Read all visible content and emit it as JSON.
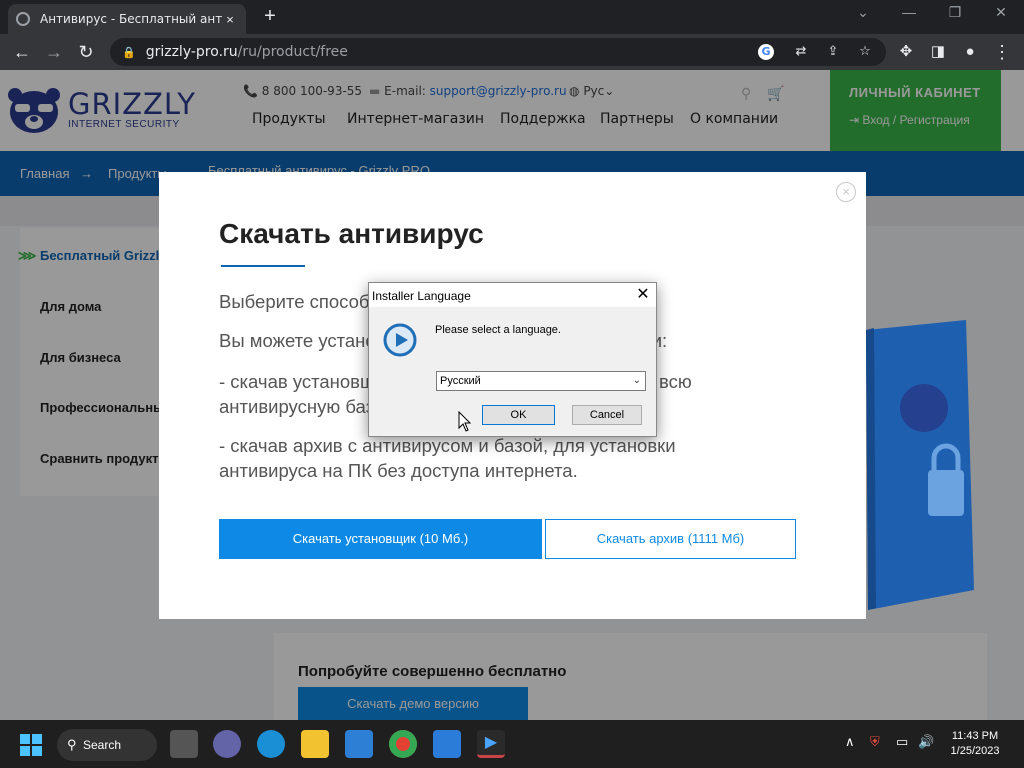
{
  "browser": {
    "tab_title": "Антивирус - Бесплатный антиви",
    "tab_close": "×",
    "new_tab": "+",
    "url_host": "grizzly-pro.ru",
    "url_path": "/ru/product/free"
  },
  "site": {
    "logo_text": "GRIZZLY",
    "logo_sub": "INTERNET SECURITY",
    "phone": "8 800 100-93-55",
    "email_label": "E-mail:",
    "email": "support@grizzly-pro.ru",
    "language": "Рус",
    "nav": [
      "Продукты",
      "Интернет-магазин",
      "Поддержка",
      "Партнеры",
      "О компании"
    ],
    "cabinet_title": "ЛИЧНЫЙ КАБИНЕТ",
    "cabinet_login": "Вход / Регистрация",
    "breadcrumbs": [
      "Главная",
      "→",
      "Продукты",
      "Бесплатный антивирус - Grizzly PRO"
    ],
    "sidebar": [
      "Бесплатный Grizzly PRO",
      "Для дома",
      "Для бизнеса",
      "Профессиональный",
      "Сравнить продукты"
    ],
    "try_title": "Попробуйте совершенно бесплатно",
    "try_button": "Скачать демо версию"
  },
  "modal": {
    "title": "Скачать антивирус",
    "subtitle": "Выберите способ установки",
    "line1": "Вы можете установить антивирус двумя способами:",
    "line2": "- скачав установщик, который скачает антивирус и всю антивирусную базу",
    "line3": "- скачав архив с антивирусом и базой, для установки антивируса на ПК без доступа интернета.",
    "btn_installer": "Скачать установщик (10 Мб.)",
    "btn_archive": "Скачать архив (1111 Мб)",
    "close": "×"
  },
  "dialog": {
    "title": "Installer Language",
    "close": "✕",
    "prompt": "Please select a language.",
    "selected_language": "Русский",
    "ok": "OK",
    "cancel": "Cancel"
  },
  "taskbar": {
    "search_label": "Search",
    "time": "11:43 PM",
    "date": "1/25/2023"
  },
  "colors": {
    "brand_blue": "#0e64b4",
    "button_blue": "#0e8ae6",
    "cabinet_green": "#3ab54a",
    "logo_navy": "#2a3b8f"
  }
}
